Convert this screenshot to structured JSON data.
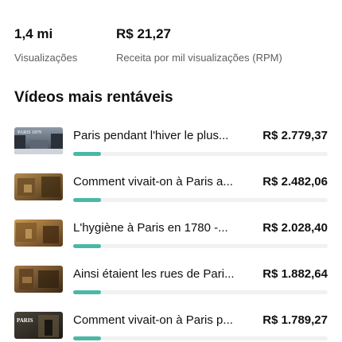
{
  "stats": [
    {
      "value": "1,4 mi",
      "label": "Visualizações"
    },
    {
      "value": "R$ 21,27",
      "label": "Receita por mil visualizações (RPM)"
    }
  ],
  "section_title": "Vídeos mais rentáveis",
  "videos": [
    {
      "title": "Paris pendant l'hiver le plus...",
      "revenue": "R$ 2.779,37",
      "bar_fraction": 0.11,
      "thumb_text": "PARIS 1879"
    },
    {
      "title": "Comment vivait-on à Paris a...",
      "revenue": "R$ 2.482,06",
      "bar_fraction": 0.11,
      "thumb_text": ""
    },
    {
      "title": "L'hygiène à Paris en 1780 -...",
      "revenue": "R$ 2.028,40",
      "bar_fraction": 0.11,
      "thumb_text": ""
    },
    {
      "title": "Ainsi étaient les rues de Pari...",
      "revenue": "R$ 1.882,64",
      "bar_fraction": 0.11,
      "thumb_text": ""
    },
    {
      "title": "Comment vivait-on à Paris p...",
      "revenue": "R$ 1.789,27",
      "bar_fraction": 0.11,
      "thumb_text": "PARIS"
    }
  ],
  "colors": {
    "bar": "#4ab8a5",
    "track": "#f1f1f1",
    "text": "#0f0f0f",
    "muted": "#606060"
  }
}
